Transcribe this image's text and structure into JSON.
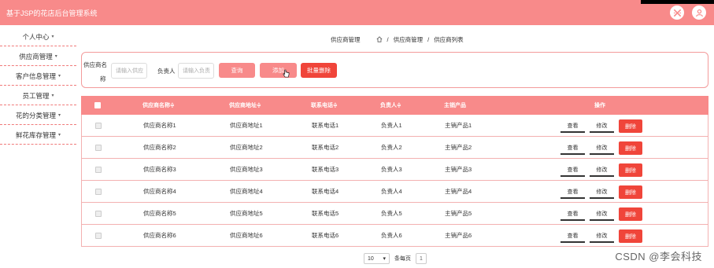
{
  "app": {
    "title": "基于JSP的花店后台管理系统"
  },
  "header_icons": [
    "close-x-icon",
    "user-icon"
  ],
  "sidebar": {
    "items": [
      {
        "label": "个人中心"
      },
      {
        "label": "供应商管理"
      },
      {
        "label": "客户信息管理"
      },
      {
        "label": "员工管理"
      },
      {
        "label": "花的分类管理"
      },
      {
        "label": "鲜花库存管理"
      }
    ]
  },
  "breadcrumb": {
    "first": "供应商管理",
    "home_icon": "home-icon",
    "second": "供应商管理",
    "third": "供应商列表",
    "sep": "/"
  },
  "search": {
    "supplier_label_1": "供应商名",
    "supplier_label_2": "称",
    "supplier_placeholder": "请输入供应",
    "owner_label": "负责人",
    "owner_placeholder": "请输入负责",
    "query_button": "查询",
    "add_button": "添加",
    "batch_delete_button": "批量删除"
  },
  "table": {
    "headers": [
      "供应商名称",
      "供应商地址",
      "联系电话",
      "负责人",
      "主销产品",
      "操作"
    ],
    "sort_marker": "≑",
    "rows": [
      {
        "name": "供应商名称1",
        "address": "供应商地址1",
        "phone": "联系电话1",
        "owner": "负责人1",
        "product": "主销产品1"
      },
      {
        "name": "供应商名称2",
        "address": "供应商地址2",
        "phone": "联系电话2",
        "owner": "负责人2",
        "product": "主销产品2"
      },
      {
        "name": "供应商名称3",
        "address": "供应商地址3",
        "phone": "联系电话3",
        "owner": "负责人3",
        "product": "主销产品3"
      },
      {
        "name": "供应商名称4",
        "address": "供应商地址4",
        "phone": "联系电话4",
        "owner": "负责人4",
        "product": "主销产品4"
      },
      {
        "name": "供应商名称5",
        "address": "供应商地址5",
        "phone": "联系电话5",
        "owner": "负责人5",
        "product": "主销产品5"
      },
      {
        "name": "供应商名称6",
        "address": "供应商地址6",
        "phone": "联系电话6",
        "owner": "负责人6",
        "product": "主销产品6"
      }
    ],
    "actions": {
      "view": "查看",
      "edit": "修改",
      "delete": "删除"
    }
  },
  "pagination": {
    "page_size": "10",
    "per_page_label": "条每页",
    "current_page": "1"
  },
  "watermark": "CSDN @李会科技",
  "colors": {
    "accent": "#f88a8a",
    "danger": "#f0453a"
  }
}
